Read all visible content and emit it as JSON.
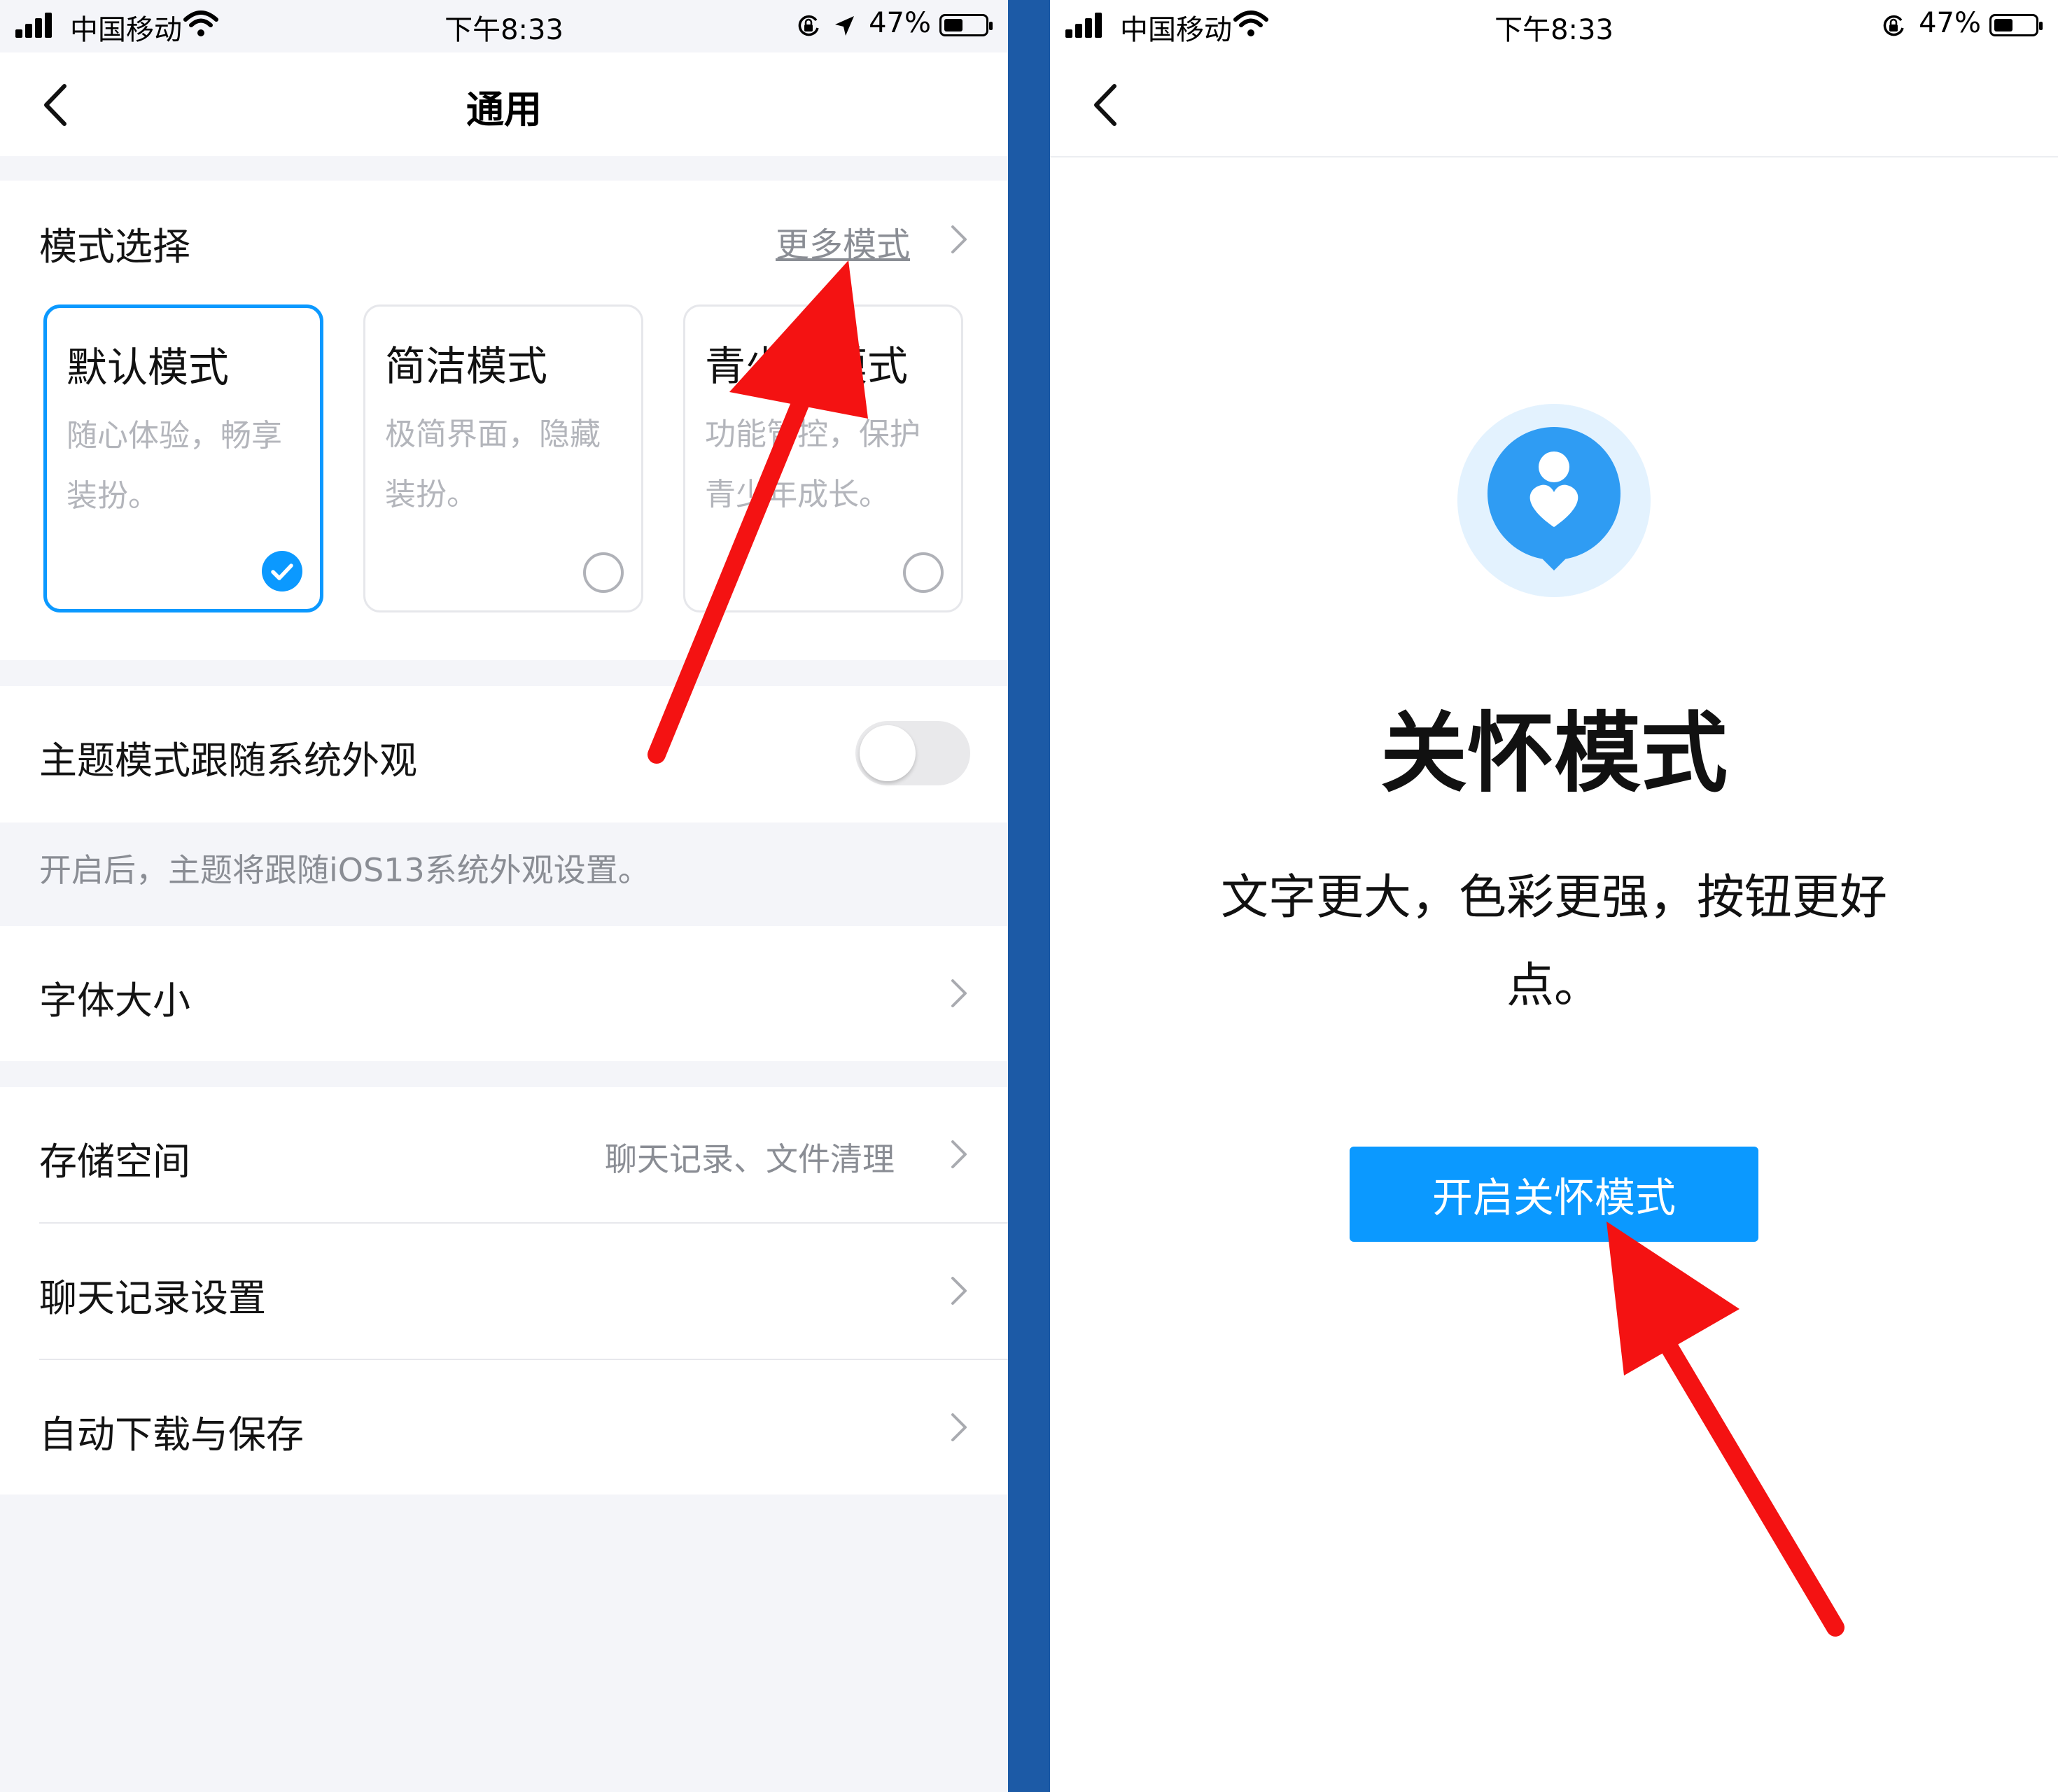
{
  "status_bar": {
    "carrier": "中国移动",
    "time": "下午8:33",
    "battery_left": "47%",
    "battery_right": "47%"
  },
  "left_screen": {
    "nav_title": "通用",
    "mode_section": {
      "title": "模式选择",
      "more_link": "更多模式",
      "modes": [
        {
          "title": "默认模式",
          "desc": "随心体验，畅享装扮。",
          "selected": true
        },
        {
          "title": "简洁模式",
          "desc": "极简界面，隐藏装扮。",
          "selected": false
        },
        {
          "title": "青少年模式",
          "desc": "功能管控，保护青少年成长。",
          "selected": false
        }
      ]
    },
    "theme_follow": {
      "label": "主题模式跟随系统外观",
      "enabled": false
    },
    "theme_hint": "开启后，主题将跟随iOS13系统外观设置。",
    "font_size": {
      "label": "字体大小"
    },
    "storage": {
      "label": "存储空间",
      "detail": "聊天记录、文件清理"
    },
    "chat_settings": {
      "label": "聊天记录设置"
    },
    "auto_download": {
      "label": "自动下载与保存"
    }
  },
  "right_screen": {
    "title": "关怀模式",
    "description": "文字更大，色彩更强，按钮更好点。",
    "button_label": "开启关怀模式"
  },
  "colors": {
    "accent": "#0b99ff",
    "divider": "#1c5aa6",
    "annotation_arrow": "#f41212"
  }
}
